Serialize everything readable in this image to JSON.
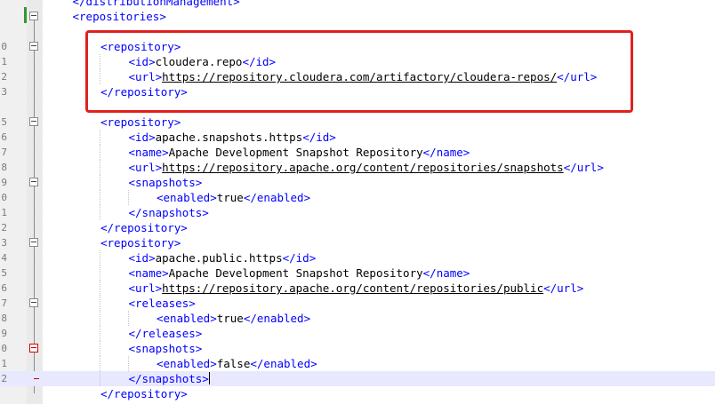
{
  "editor": {
    "lines": [
      {
        "num": "",
        "indent": 1,
        "tokens": [
          {
            "t": "tag",
            "v": "</distributionManagement>"
          }
        ]
      },
      {
        "num": "",
        "indent": 1,
        "tokens": [
          {
            "t": "tag",
            "v": "<repositories>"
          }
        ]
      },
      {
        "num": "",
        "indent": 0,
        "tokens": []
      },
      {
        "num": "0",
        "indent": 2,
        "tokens": [
          {
            "t": "tag",
            "v": "<repository>"
          }
        ]
      },
      {
        "num": "1",
        "indent": 3,
        "tokens": [
          {
            "t": "tag",
            "v": "<id>"
          },
          {
            "t": "txt",
            "v": "cloudera.repo"
          },
          {
            "t": "tag",
            "v": "</id>"
          }
        ]
      },
      {
        "num": "2",
        "indent": 3,
        "tokens": [
          {
            "t": "tag",
            "v": "<url>"
          },
          {
            "t": "url",
            "v": "https://repository.cloudera.com/artifactory/cloudera-repos/"
          },
          {
            "t": "tag",
            "v": "</url>"
          }
        ]
      },
      {
        "num": "3",
        "indent": 2,
        "tokens": [
          {
            "t": "tag",
            "v": "</repository>"
          }
        ]
      },
      {
        "num": "",
        "indent": 0,
        "tokens": []
      },
      {
        "num": "5",
        "indent": 2,
        "tokens": [
          {
            "t": "tag",
            "v": "<repository>"
          }
        ]
      },
      {
        "num": "6",
        "indent": 3,
        "tokens": [
          {
            "t": "tag",
            "v": "<id>"
          },
          {
            "t": "txt",
            "v": "apache.snapshots.https"
          },
          {
            "t": "tag",
            "v": "</id>"
          }
        ]
      },
      {
        "num": "7",
        "indent": 3,
        "tokens": [
          {
            "t": "tag",
            "v": "<name>"
          },
          {
            "t": "txt",
            "v": "Apache Development Snapshot Repository"
          },
          {
            "t": "tag",
            "v": "</name>"
          }
        ]
      },
      {
        "num": "8",
        "indent": 3,
        "tokens": [
          {
            "t": "tag",
            "v": "<url>"
          },
          {
            "t": "url",
            "v": "https://repository.apache.org/content/repositories/snapshots"
          },
          {
            "t": "tag",
            "v": "</url>"
          }
        ]
      },
      {
        "num": "9",
        "indent": 3,
        "tokens": [
          {
            "t": "tag",
            "v": "<snapshots>"
          }
        ]
      },
      {
        "num": "0",
        "indent": 4,
        "tokens": [
          {
            "t": "tag",
            "v": "<enabled>"
          },
          {
            "t": "txt",
            "v": "true"
          },
          {
            "t": "tag",
            "v": "</enabled>"
          }
        ]
      },
      {
        "num": "1",
        "indent": 3,
        "tokens": [
          {
            "t": "tag",
            "v": "</snapshots>"
          }
        ]
      },
      {
        "num": "2",
        "indent": 2,
        "tokens": [
          {
            "t": "tag",
            "v": "</repository>"
          }
        ]
      },
      {
        "num": "3",
        "indent": 2,
        "tokens": [
          {
            "t": "tag",
            "v": "<repository>"
          }
        ]
      },
      {
        "num": "4",
        "indent": 3,
        "tokens": [
          {
            "t": "tag",
            "v": "<id>"
          },
          {
            "t": "txt",
            "v": "apache.public.https"
          },
          {
            "t": "tag",
            "v": "</id>"
          }
        ]
      },
      {
        "num": "5",
        "indent": 3,
        "tokens": [
          {
            "t": "tag",
            "v": "<name>"
          },
          {
            "t": "txt",
            "v": "Apache Development Snapshot Repository"
          },
          {
            "t": "tag",
            "v": "</name>"
          }
        ]
      },
      {
        "num": "6",
        "indent": 3,
        "tokens": [
          {
            "t": "tag",
            "v": "<url>"
          },
          {
            "t": "url",
            "v": "https://repository.apache.org/content/repositories/public"
          },
          {
            "t": "tag",
            "v": "</url>"
          }
        ]
      },
      {
        "num": "7",
        "indent": 3,
        "tokens": [
          {
            "t": "tag",
            "v": "<releases>"
          }
        ]
      },
      {
        "num": "8",
        "indent": 4,
        "tokens": [
          {
            "t": "tag",
            "v": "<enabled>"
          },
          {
            "t": "txt",
            "v": "true"
          },
          {
            "t": "tag",
            "v": "</enabled>"
          }
        ]
      },
      {
        "num": "9",
        "indent": 3,
        "tokens": [
          {
            "t": "tag",
            "v": "</releases>"
          }
        ]
      },
      {
        "num": "0",
        "indent": 3,
        "tokens": [
          {
            "t": "tag",
            "v": "<snapshots>"
          }
        ]
      },
      {
        "num": "1",
        "indent": 4,
        "tokens": [
          {
            "t": "tag",
            "v": "<enabled>"
          },
          {
            "t": "txt",
            "v": "false"
          },
          {
            "t": "tag",
            "v": "</enabled>"
          }
        ]
      },
      {
        "num": "2",
        "indent": 3,
        "current": true,
        "tokens": [
          {
            "t": "tag",
            "v": "</snapshots>"
          }
        ]
      },
      {
        "num": "",
        "indent": 2,
        "tokens": [
          {
            "t": "tag",
            "v": "</repository>"
          }
        ]
      }
    ]
  },
  "colors": {
    "tag": "#0000ff",
    "text": "#000000",
    "highlight_box": "#e02020",
    "current_line": "#e8e8ff",
    "change_bar": "#2e9a2e"
  }
}
